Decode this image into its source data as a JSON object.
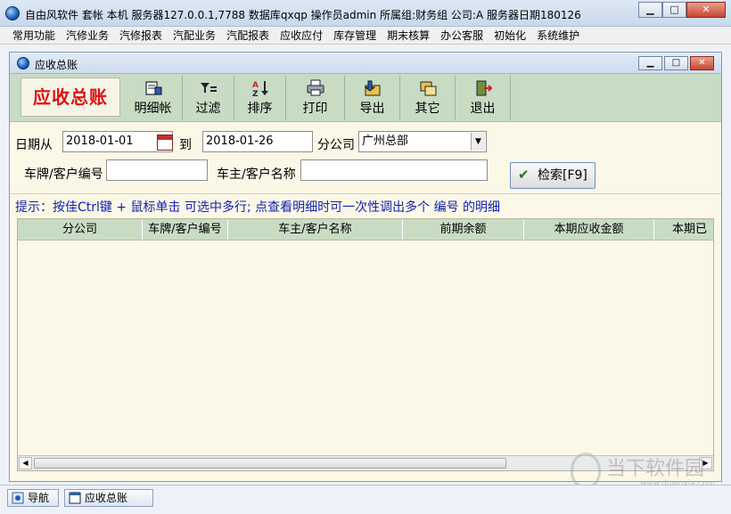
{
  "window": {
    "title": "自由风软件  套帐 本机  服务器127.0.0.1,7788  数据库qxqp  操作员admin  所属组:财务组  公司:A  服务器日期180126",
    "buttons": [
      "minimize-icon",
      "maximize-icon",
      "close-icon"
    ]
  },
  "menu": [
    "常用功能",
    "汽修业务",
    "汽修报表",
    "汽配业务",
    "汽配报表",
    "应收应付",
    "库存管理",
    "期末核算",
    "办公客服",
    "初始化",
    "系统维护"
  ],
  "child_window": {
    "title": "应收总账"
  },
  "toolbar": {
    "big_title": "应收总账",
    "buttons": [
      {
        "label": "明细帐",
        "icon": "ledger-detail-icon"
      },
      {
        "label": "过滤",
        "icon": "filter-icon"
      },
      {
        "label": "排序",
        "icon": "sort-icon"
      },
      {
        "label": "打印",
        "icon": "printer-icon"
      },
      {
        "label": "导出",
        "icon": "export-icon"
      },
      {
        "label": "其它",
        "icon": "other-icon"
      },
      {
        "label": "退出",
        "icon": "exit-icon"
      }
    ]
  },
  "filters": {
    "date_from_label": "日期从",
    "date_from": "2018-01-01",
    "to_label": "到",
    "date_to": "2018-01-26",
    "branch_label": "分公司",
    "branch_value": "广州总部",
    "plate_label": "车牌/客户编号",
    "plate_value": "",
    "owner_label": "车主/客户名称",
    "owner_value": "",
    "search_label": "检索[F9]"
  },
  "hint": "提示：按佳Ctrl键 + 鼠标单击 可选中多行; 点查看明细时可一次性调出多个 编号 的明细",
  "table": {
    "columns": [
      "分公司",
      "车牌/客户编号",
      "车主/客户名称",
      "前期余额",
      "本期应收金额",
      "本期已"
    ],
    "rows": []
  },
  "watermark": {
    "text": "当下软件园",
    "url": "www.downxia.com"
  },
  "taskbar": [
    {
      "label": "导航",
      "icon": "navigation-icon"
    },
    {
      "label": "应收总账",
      "icon": "window-icon"
    }
  ],
  "colors": {
    "accent_green": "#c8dcc4",
    "panel_bg": "#fcf8e8",
    "title_red": "#e01010",
    "hint_blue": "#1220b8"
  }
}
